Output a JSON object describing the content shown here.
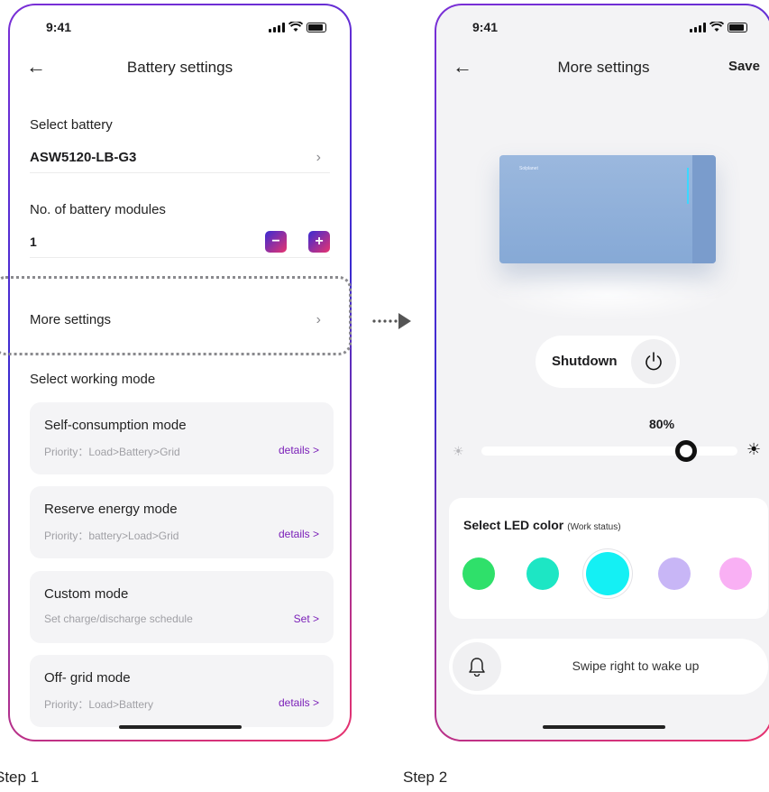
{
  "step1": {
    "status_time": "9:41",
    "title": "Battery settings",
    "select_battery_label": "Select battery",
    "battery_model": "ASW5120-LB-G3",
    "modules_label": "No. of battery modules",
    "modules_value": "1",
    "minus_label": "−",
    "plus_label": "+",
    "more_settings_label": "More settings",
    "working_mode_label": "Select working mode",
    "modes": [
      {
        "title": "Self-consumption mode",
        "subtitle": "Priority：Load>Battery>Grid",
        "action": "details >"
      },
      {
        "title": "Reserve energy mode",
        "subtitle": "Priority：battery>Load>Grid",
        "action": "details >"
      },
      {
        "title": "Custom mode",
        "subtitle": "Set charge/discharge schedule",
        "action": "Set >"
      },
      {
        "title": "Off- grid mode",
        "subtitle": "Priority：Load>Battery",
        "action": "details >"
      }
    ],
    "caption": "Step 1"
  },
  "step2": {
    "status_time": "9:41",
    "title": "More settings",
    "save_label": "Save",
    "device_logo_text": "Solplanet",
    "shutdown_label": "Shutdown",
    "brightness_label": "80%",
    "brightness_value": 0.8,
    "led_title": "Select LED color",
    "led_subtitle": "(Work status)",
    "led_colors": [
      "#2fe06a",
      "#1de6c4",
      "#14f0f4",
      "#c8b6f6",
      "#f9b0f4"
    ],
    "led_selected_index": 2,
    "wake_label": "Swipe right to wake up",
    "caption": "Step 2"
  },
  "icons": [
    "back-arrow-icon",
    "chevron-right-icon",
    "power-icon",
    "bell-icon",
    "sun-icon",
    "signal-icon",
    "wifi-icon",
    "battery-icon",
    "dotted-arrow-icon"
  ],
  "colors": {
    "accent_purple": "#7a1fb8",
    "gradient_start": "#3b2bd3",
    "gradient_end": "#e8336f"
  }
}
